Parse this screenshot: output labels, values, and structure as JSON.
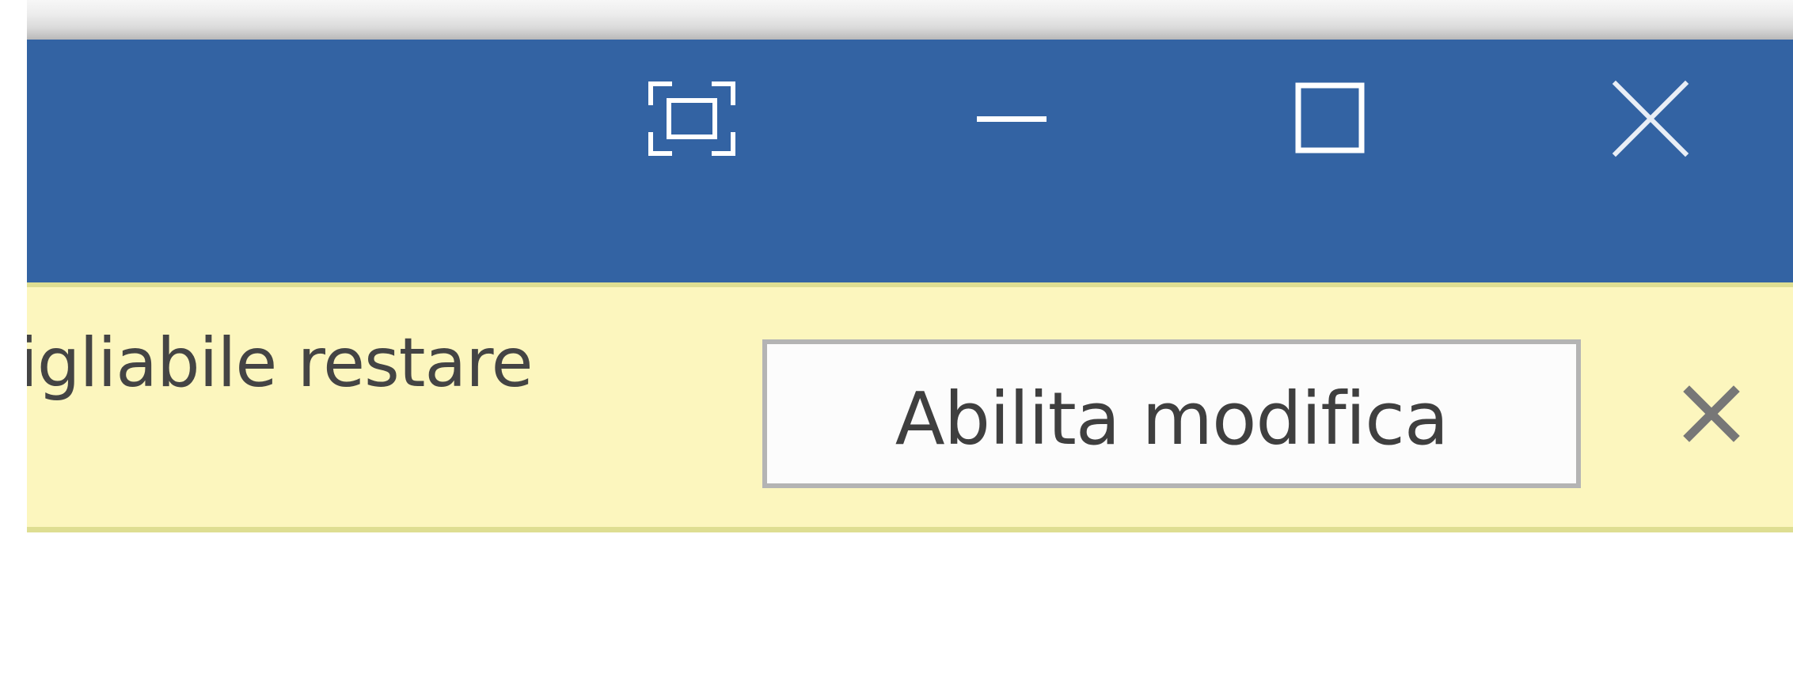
{
  "window": {
    "controls": {
      "fullscreen_icon": "fullscreen-icon",
      "minimize_icon": "minimize-icon",
      "maximize_icon": "maximize-icon",
      "close_icon": "close-icon"
    }
  },
  "infobar": {
    "message": "igliabile restare",
    "enable_editing_label": "Abilita modifica",
    "dismiss_icon": "close-icon"
  },
  "colors": {
    "titlebar": "#3363a3",
    "infobar_background": "#fcf6be",
    "infobar_border": "#dede92",
    "button_border": "#b4b4b4",
    "text": "#444444"
  }
}
